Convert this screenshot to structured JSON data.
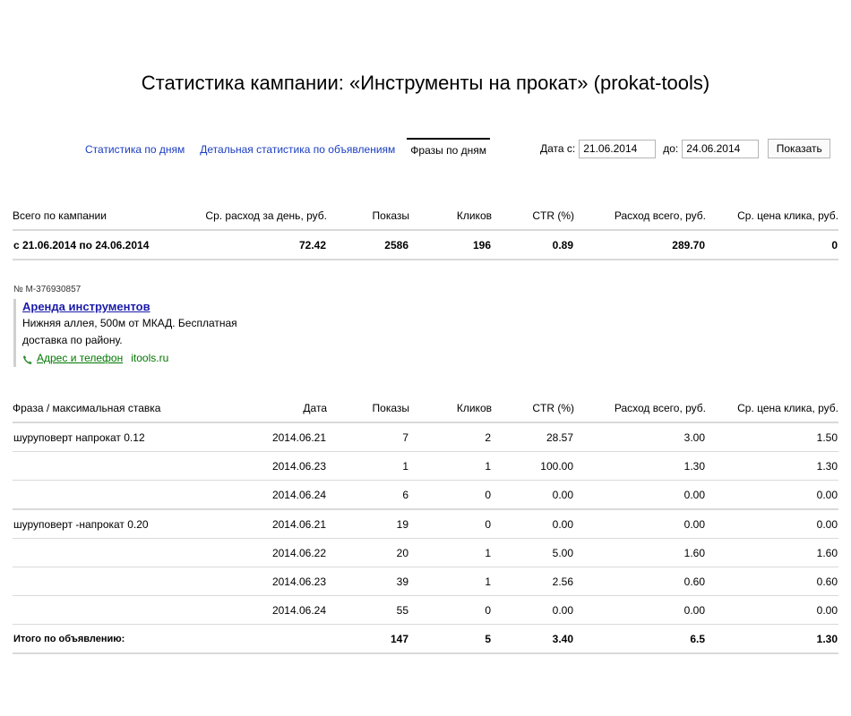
{
  "header": {
    "title": "Статистика кампании: «Инструменты на прокат» (prokat-tools)"
  },
  "nav": {
    "tab_days": "Статистика по дням",
    "tab_detailed": "Детальная статистика по объявлениям",
    "tab_phrases": "Фразы по дням"
  },
  "date_filter": {
    "from_label": "Дата с:",
    "from_value": "21.06.2014",
    "to_label": "до:",
    "to_value": "24.06.2014",
    "show_button": "Показать"
  },
  "campaign_summary": {
    "headers": [
      "Всего по кампании",
      "Ср. расход за день, руб.",
      "Показы",
      "Кликов",
      "CTR (%)",
      "Расход всего, руб.",
      "Ср. цена клика, руб."
    ],
    "row": [
      "с 21.06.2014 по 24.06.2014",
      "72.42",
      "2586",
      "196",
      "0.89",
      "289.70",
      "0"
    ]
  },
  "ad": {
    "id": "№ M-376930857",
    "title": "Аренда инструментов",
    "text_line1": "Нижняя аллея, 500м от МКАД. Бесплатная",
    "text_line2": "доставка по району.",
    "contact_link": "Адрес и телефон",
    "domain": "itools.ru",
    "link_color": "#007700",
    "title_color": "#1a1aaa"
  },
  "phrase_stats": {
    "headers": [
      "Фраза / максимальная ставка",
      "Дата",
      "Показы",
      "Кликов",
      "CTR (%)",
      "Расход всего, руб.",
      "Ср. цена клика, руб."
    ],
    "rows": [
      [
        "шуруповерт напрокат 0.12",
        "2014.06.21",
        "7",
        "2",
        "28.57",
        "3.00",
        "1.50"
      ],
      [
        "",
        "2014.06.23",
        "1",
        "1",
        "100.00",
        "1.30",
        "1.30"
      ],
      [
        "",
        "2014.06.24",
        "6",
        "0",
        "0.00",
        "0.00",
        "0.00"
      ],
      [
        "шуруповерт -напрокат 0.20",
        "2014.06.21",
        "19",
        "0",
        "0.00",
        "0.00",
        "0.00"
      ],
      [
        "",
        "2014.06.22",
        "20",
        "1",
        "5.00",
        "1.60",
        "1.60"
      ],
      [
        "",
        "2014.06.23",
        "39",
        "1",
        "2.56",
        "0.60",
        "0.60"
      ],
      [
        "",
        "2014.06.24",
        "55",
        "0",
        "0.00",
        "0.00",
        "0.00"
      ]
    ],
    "total": [
      "Итого по объявлению:",
      "",
      "147",
      "5",
      "3.40",
      "6.5",
      "1.30"
    ]
  },
  "colors": {
    "nav_link": "#1a3dc1",
    "divider": "#d9d9d9"
  }
}
